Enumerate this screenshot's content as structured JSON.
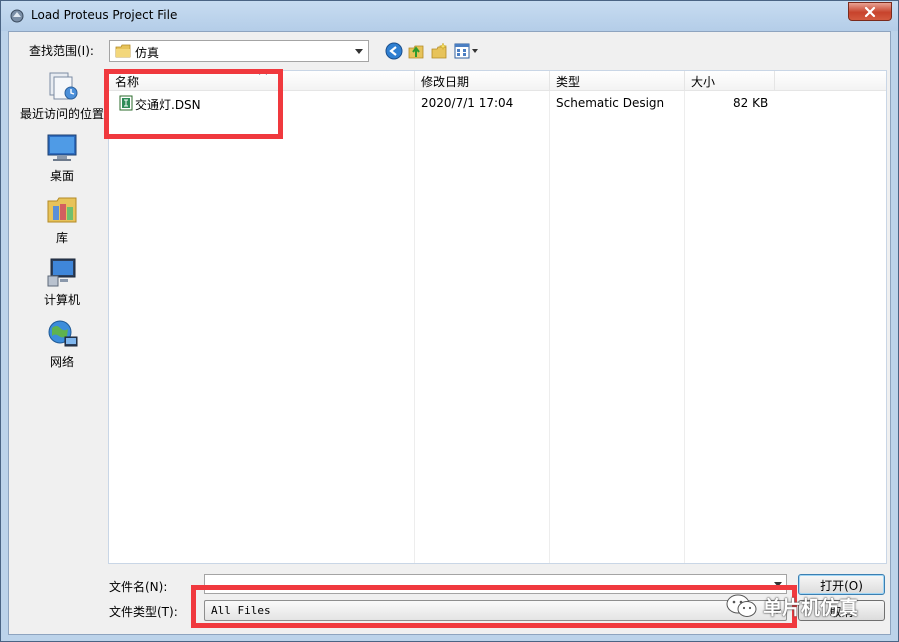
{
  "window": {
    "title": "Load Proteus Project File",
    "close_icon": "close-icon"
  },
  "toolbar": {
    "lookin_label": "查找范围(I):",
    "lookin_value": "仿真",
    "buttons": [
      "back-icon",
      "up-folder-icon",
      "new-folder-icon",
      "view-menu-icon"
    ]
  },
  "places": [
    {
      "label": "最近访问的位置",
      "icon": "recent-places-icon"
    },
    {
      "label": "桌面",
      "icon": "desktop-icon"
    },
    {
      "label": "库",
      "icon": "libraries-icon"
    },
    {
      "label": "计算机",
      "icon": "computer-icon"
    },
    {
      "label": "网络",
      "icon": "network-icon"
    }
  ],
  "filelist": {
    "columns": [
      "名称",
      "修改日期",
      "类型",
      "大小"
    ],
    "rows": [
      {
        "name": "交通灯.DSN",
        "modified": "2020/7/1 17:04",
        "type": "Schematic Design",
        "size": "82 KB"
      }
    ]
  },
  "form": {
    "filename_label": "文件名(N):",
    "filename_value": "",
    "filetype_label": "文件类型(T):",
    "filetype_value": "All Files"
  },
  "buttons": {
    "open": "打开(O)",
    "cancel": "取消"
  },
  "watermark": {
    "text": "单片机仿真"
  },
  "colors": {
    "highlight": "#f0393e",
    "titlebar": "#b9d1ea",
    "close": "#c7432c"
  }
}
